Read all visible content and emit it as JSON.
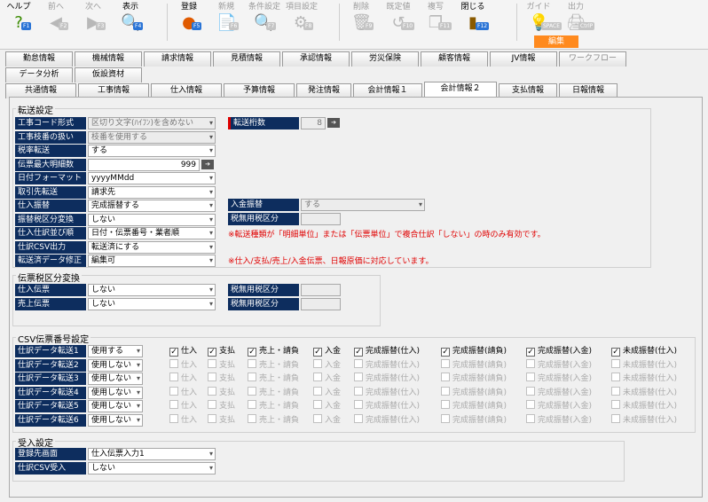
{
  "toolbar": {
    "buttons": [
      {
        "label": "ヘルプ",
        "key": "F1",
        "icon": "?"
      },
      {
        "label": "前へ",
        "key": "F2",
        "icon": "◀"
      },
      {
        "label": "次へ",
        "key": "F3",
        "icon": "▶"
      },
      {
        "label": "表示",
        "key": "F4",
        "icon": "🔍"
      },
      {
        "label": "登録",
        "key": "F5",
        "icon": "●"
      },
      {
        "label": "新規",
        "key": "F6",
        "icon": "📄"
      },
      {
        "label": "条件設定",
        "key": "F7",
        "icon": "🔍"
      },
      {
        "label": "項目設定",
        "key": "F8",
        "icon": "⚙"
      },
      {
        "label": "削除",
        "key": "F9",
        "icon": "🗑"
      },
      {
        "label": "既定値",
        "key": "F10",
        "icon": "↺"
      },
      {
        "label": "複写",
        "key": "F11",
        "icon": "❐"
      },
      {
        "label": "閉じる",
        "key": "F12",
        "icon": "▮"
      },
      {
        "label": "ガイド",
        "key": "SPACE",
        "icon": "💡"
      },
      {
        "label": "出力",
        "key": "CtrlP",
        "icon": "🖨"
      }
    ],
    "mode_label": "編集"
  },
  "tabs_row1": [
    "勤怠情報",
    "機械情報",
    "請求情報",
    "見積情報",
    "承認情報",
    "労災保険",
    "顧客情報",
    "JV情報",
    "ワークフロー"
  ],
  "tabs_row2": [
    "データ分析",
    "仮設資材"
  ],
  "tabs_row3": [
    "共通情報",
    "工事情報",
    "仕入情報",
    "予算情報",
    "発注情報",
    "会計情報１",
    "会計情報２",
    "支払情報",
    "日報情報"
  ],
  "transfer": {
    "title": "転送設定",
    "rows": [
      {
        "label": "工事コード形式",
        "value": "区切り文字(ﾊｲﾌﾝ)を含めない"
      },
      {
        "label": "工事枝番の扱い",
        "value": "枝番を使用する"
      },
      {
        "label": "税率転送",
        "value": "する"
      },
      {
        "label": "伝票最大明細数",
        "value": "999"
      },
      {
        "label": "日付フォーマット",
        "value": "yyyyMMdd"
      },
      {
        "label": "取引先転送",
        "value": "請求先"
      },
      {
        "label": "仕入振替",
        "value": "完成振替する"
      },
      {
        "label": "振替税区分変換",
        "value": "しない"
      },
      {
        "label": "仕入仕訳並び順",
        "value": "日付・伝票番号・業者順"
      },
      {
        "label": "仕訳CSV出力",
        "value": "転送済にする"
      },
      {
        "label": "転送済データ修正",
        "value": "編集可"
      }
    ],
    "digits_label": "転送桁数",
    "digits_value": "8",
    "deposit_label": "入金振替",
    "deposit_value": "する",
    "tax_exempt_label": "税無用税区分",
    "note1": "※転送種類が「明細単位」または「伝票単位」で複合仕訳「しない」の時のみ有効です。",
    "note2": "※仕入/支払/売上/入金伝票、日報原価に対応しています。"
  },
  "slip_tax": {
    "title": "伝票税区分変換",
    "rows": [
      {
        "label": "仕入伝票",
        "value": "しない",
        "tax_label": "税無用税区分"
      },
      {
        "label": "売上伝票",
        "value": "しない",
        "tax_label": "税無用税区分"
      }
    ]
  },
  "csv": {
    "title": "CSV伝票番号設定",
    "check_labels": [
      "仕入",
      "支払",
      "売上・請負",
      "入金",
      "完成振替(仕入)",
      "完成振替(請負)",
      "完成振替(入金)",
      "未成振替(仕入)"
    ],
    "rows": [
      {
        "label": "仕訳データ転送1",
        "value": "使用する"
      },
      {
        "label": "仕訳データ転送2",
        "value": "使用しない"
      },
      {
        "label": "仕訳データ転送3",
        "value": "使用しない"
      },
      {
        "label": "仕訳データ転送4",
        "value": "使用しない"
      },
      {
        "label": "仕訳データ転送5",
        "value": "使用しない"
      },
      {
        "label": "仕訳データ転送6",
        "value": "使用しない"
      }
    ]
  },
  "receive": {
    "title": "受入設定",
    "rows": [
      {
        "label": "登録先画面",
        "value": "仕入伝票入力1"
      },
      {
        "label": "仕訳CSV受入",
        "value": "しない"
      }
    ]
  }
}
